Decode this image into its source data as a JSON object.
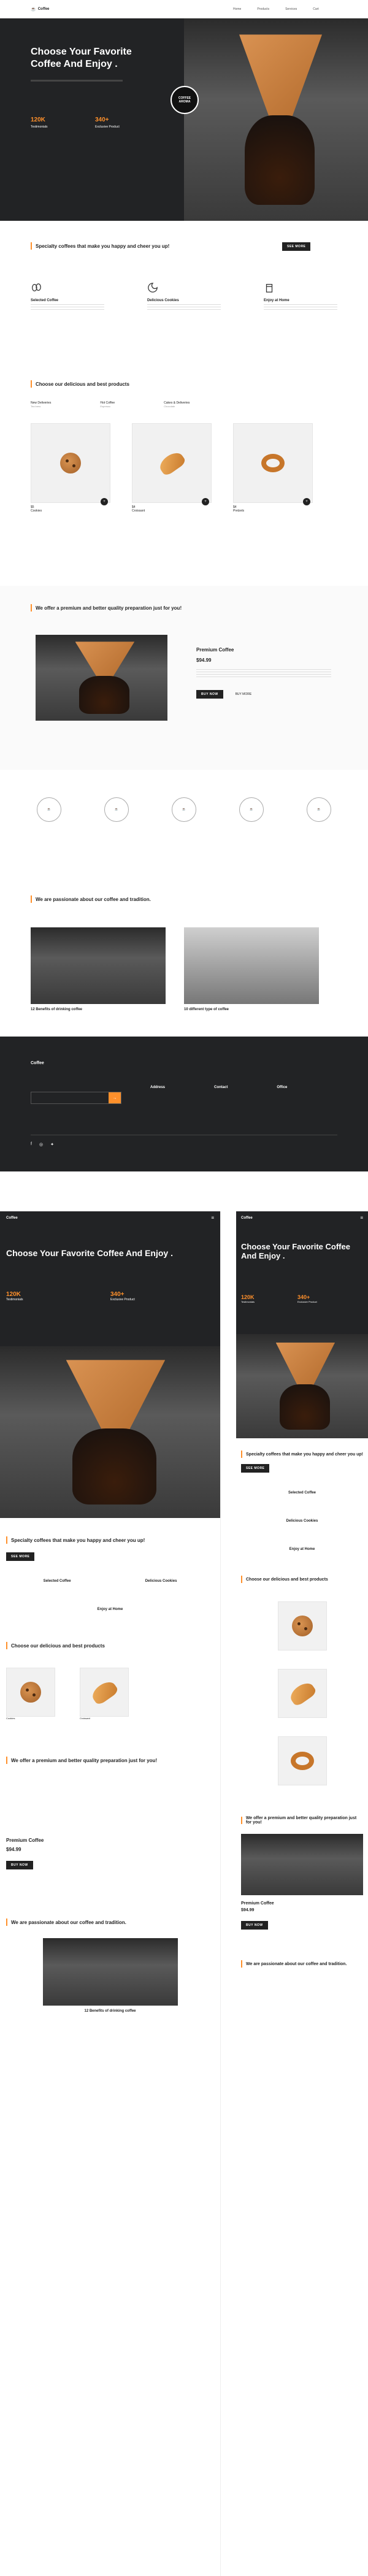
{
  "nav": {
    "logo": "Coffee",
    "links": [
      "Home",
      "Products",
      "Services"
    ],
    "cart_label": "Cart"
  },
  "hero": {
    "title": "Choose Your Favorite Coffee And Enjoy .",
    "stat1_value": "120K",
    "stat1_label": "Testimonials",
    "stat2_value": "340+",
    "stat2_label": "Exclusive Product",
    "badge_line1": "COFFEE",
    "badge_line2": "AROMA"
  },
  "specialty": {
    "title": "Specialty coffees that make you happy and cheer you up!",
    "button": "SEE MORE",
    "features": [
      {
        "title": "Selected Coffee",
        "icon": "coffee-beans-icon"
      },
      {
        "title": "Delicious Cookies",
        "icon": "cookie-icon"
      },
      {
        "title": "Enjoy at Home",
        "icon": "coffee-cup-icon"
      }
    ]
  },
  "products": {
    "title": "Choose our delicious and best products",
    "filters": [
      {
        "label": "New Deliveries",
        "sub": "Tea brew"
      },
      {
        "label": "Hot Coffee",
        "sub": "Espresso"
      },
      {
        "label": "Cakes & Deliveries",
        "sub": "Chocolate"
      }
    ],
    "items": [
      {
        "price": "$5",
        "name": "Cookies"
      },
      {
        "price": "$4",
        "name": "Croissant"
      },
      {
        "price": "$4",
        "name": "Pretzels"
      }
    ]
  },
  "premium": {
    "title": "We offer a premium and better quality preparation just for you!",
    "product_name": "Premium Coffee",
    "price": "$94.99",
    "buy_button": "BUY NOW",
    "more_button": "BUY MORE"
  },
  "blog": {
    "title": "We are passionate about our coffee and tradition.",
    "posts": [
      {
        "title": "12 Benefits of drinking coffee"
      },
      {
        "title": "10 different type of coffee"
      }
    ]
  },
  "footer": {
    "logo": "Coffee",
    "subscribe_button": "→",
    "columns": [
      "Address",
      "Contact",
      "Office"
    ]
  },
  "colors": {
    "accent": "#ff902b",
    "dark": "#222325"
  }
}
